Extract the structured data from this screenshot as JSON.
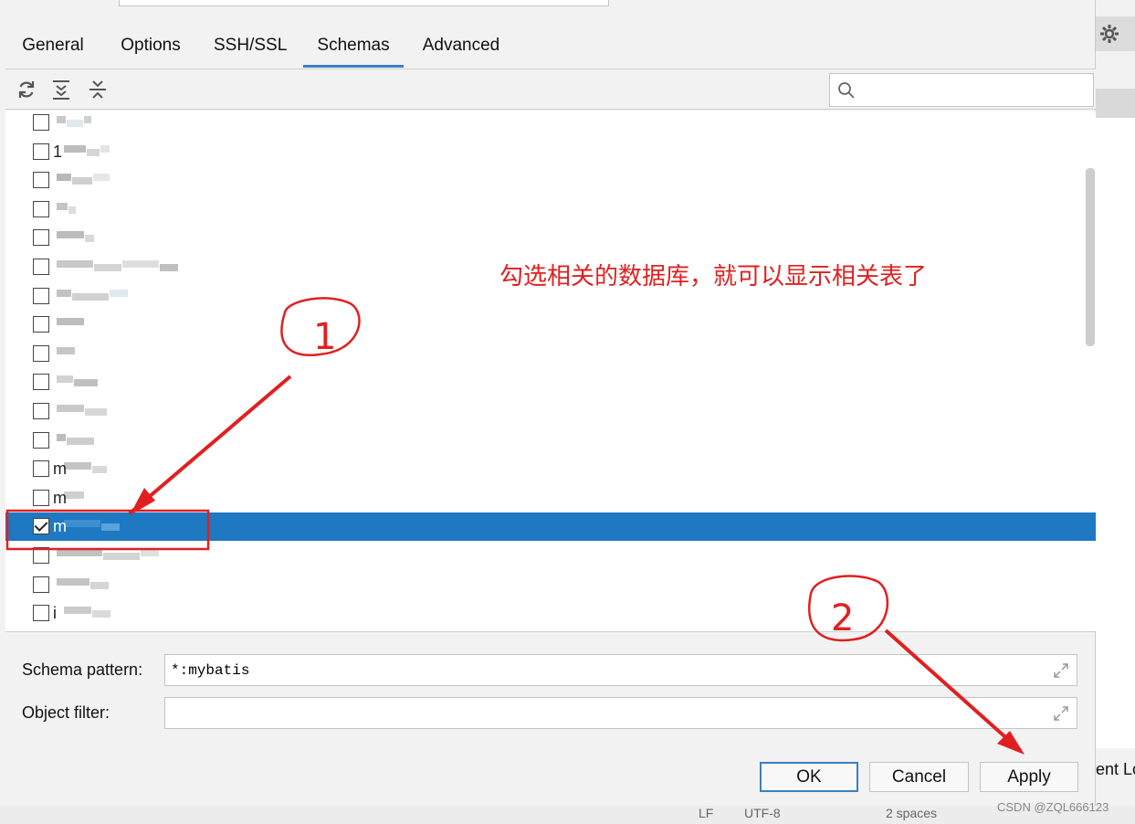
{
  "tabs": [
    {
      "label": "General",
      "active": false
    },
    {
      "label": "Options",
      "active": false
    },
    {
      "label": "SSH/SSL",
      "active": false
    },
    {
      "label": "Schemas",
      "active": true
    },
    {
      "label": "Advanced",
      "active": false
    }
  ],
  "toolbar": {
    "icons": [
      "refresh-icon",
      "expand-all-icon",
      "collapse-all-icon"
    ],
    "search_value": ""
  },
  "schemas": [
    {
      "label": "",
      "checked": false
    },
    {
      "label": "1",
      "checked": false
    },
    {
      "label": "",
      "checked": false
    },
    {
      "label": "",
      "checked": false
    },
    {
      "label": "",
      "checked": false
    },
    {
      "label": "",
      "checked": false
    },
    {
      "label": "",
      "checked": false
    },
    {
      "label": "",
      "checked": false
    },
    {
      "label": "",
      "checked": false
    },
    {
      "label": "",
      "checked": false
    },
    {
      "label": "",
      "checked": false
    },
    {
      "label": "",
      "checked": false
    },
    {
      "label": "m",
      "checked": false
    },
    {
      "label": "m",
      "checked": false
    },
    {
      "label": "m",
      "checked": true,
      "selected": true
    },
    {
      "label": "",
      "checked": false
    },
    {
      "label": "",
      "checked": false
    },
    {
      "label": "i",
      "checked": false
    }
  ],
  "annotation": {
    "text": "勾选相关的数据库，就可以显示相关表了",
    "marker1": "1",
    "marker2": "2",
    "color": "#e02020"
  },
  "fields": {
    "schema_pattern_label": "Schema pattern:",
    "schema_pattern_value": "*:mybatis",
    "object_filter_label": "Object filter:",
    "object_filter_value": ""
  },
  "buttons": {
    "ok": "OK",
    "cancel": "Cancel",
    "apply": "Apply"
  },
  "right_panel": {
    "text": "ent Lo"
  },
  "statusbar": {
    "items": [
      "LF",
      "UTF-8",
      "2 spaces"
    ]
  },
  "watermark": "CSDN @ZQL666123",
  "colors": {
    "selection": "#1e78c2",
    "accent": "#3c7ec5",
    "annotation": "#e02020"
  }
}
